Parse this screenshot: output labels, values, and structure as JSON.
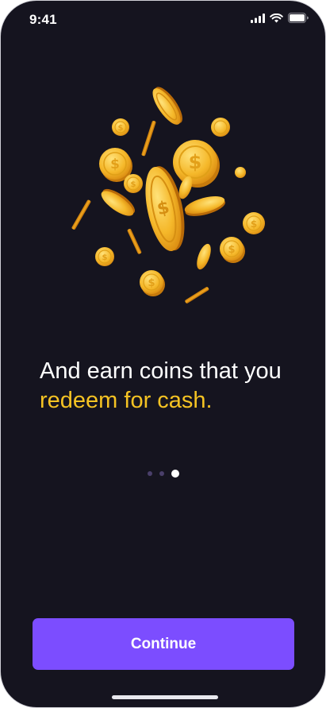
{
  "status_bar": {
    "time": "9:41",
    "icons": [
      "signal-icon",
      "wifi-icon",
      "battery-icon"
    ]
  },
  "hero": {
    "illustration": "gold-coins-illustration",
    "headline_plain": "And earn coins that you ",
    "headline_accent": "redeem for cash."
  },
  "pager": {
    "count": 3,
    "active_index": 2
  },
  "actions": {
    "continue_label": "Continue"
  },
  "colors": {
    "background": "#15141f",
    "accent_text": "#f5c323",
    "button": "#7c4dff",
    "coin_gold": "#f3b622"
  }
}
